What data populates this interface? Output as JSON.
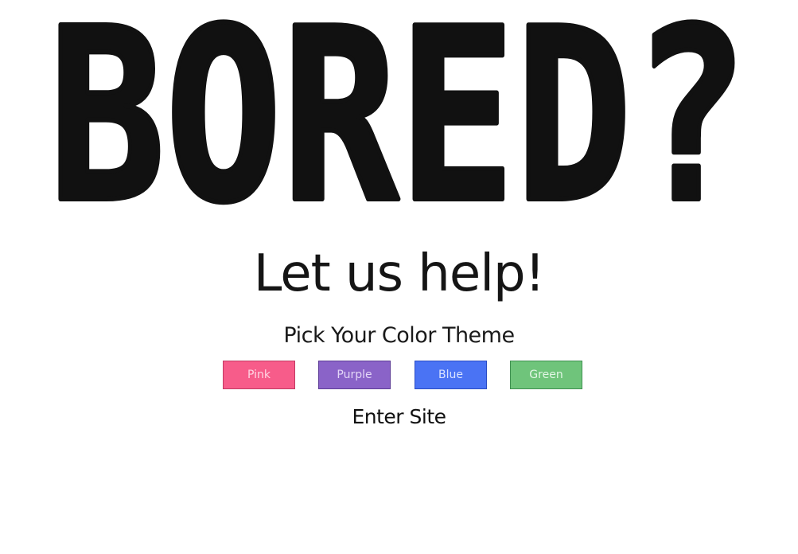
{
  "hero": {
    "title": "BORED?"
  },
  "tagline": "Let us help!",
  "themes": {
    "heading": "Pick Your Color Theme",
    "options": [
      {
        "label": "Pink",
        "color": "#f75c8a"
      },
      {
        "label": "Purple",
        "color": "#8a63c8"
      },
      {
        "label": "Blue",
        "color": "#4a73f4"
      },
      {
        "label": "Green",
        "color": "#6fc47b"
      }
    ]
  },
  "enter_label": "Enter Site",
  "colors": {
    "ink": "#111111",
    "background": "#ffffff"
  }
}
